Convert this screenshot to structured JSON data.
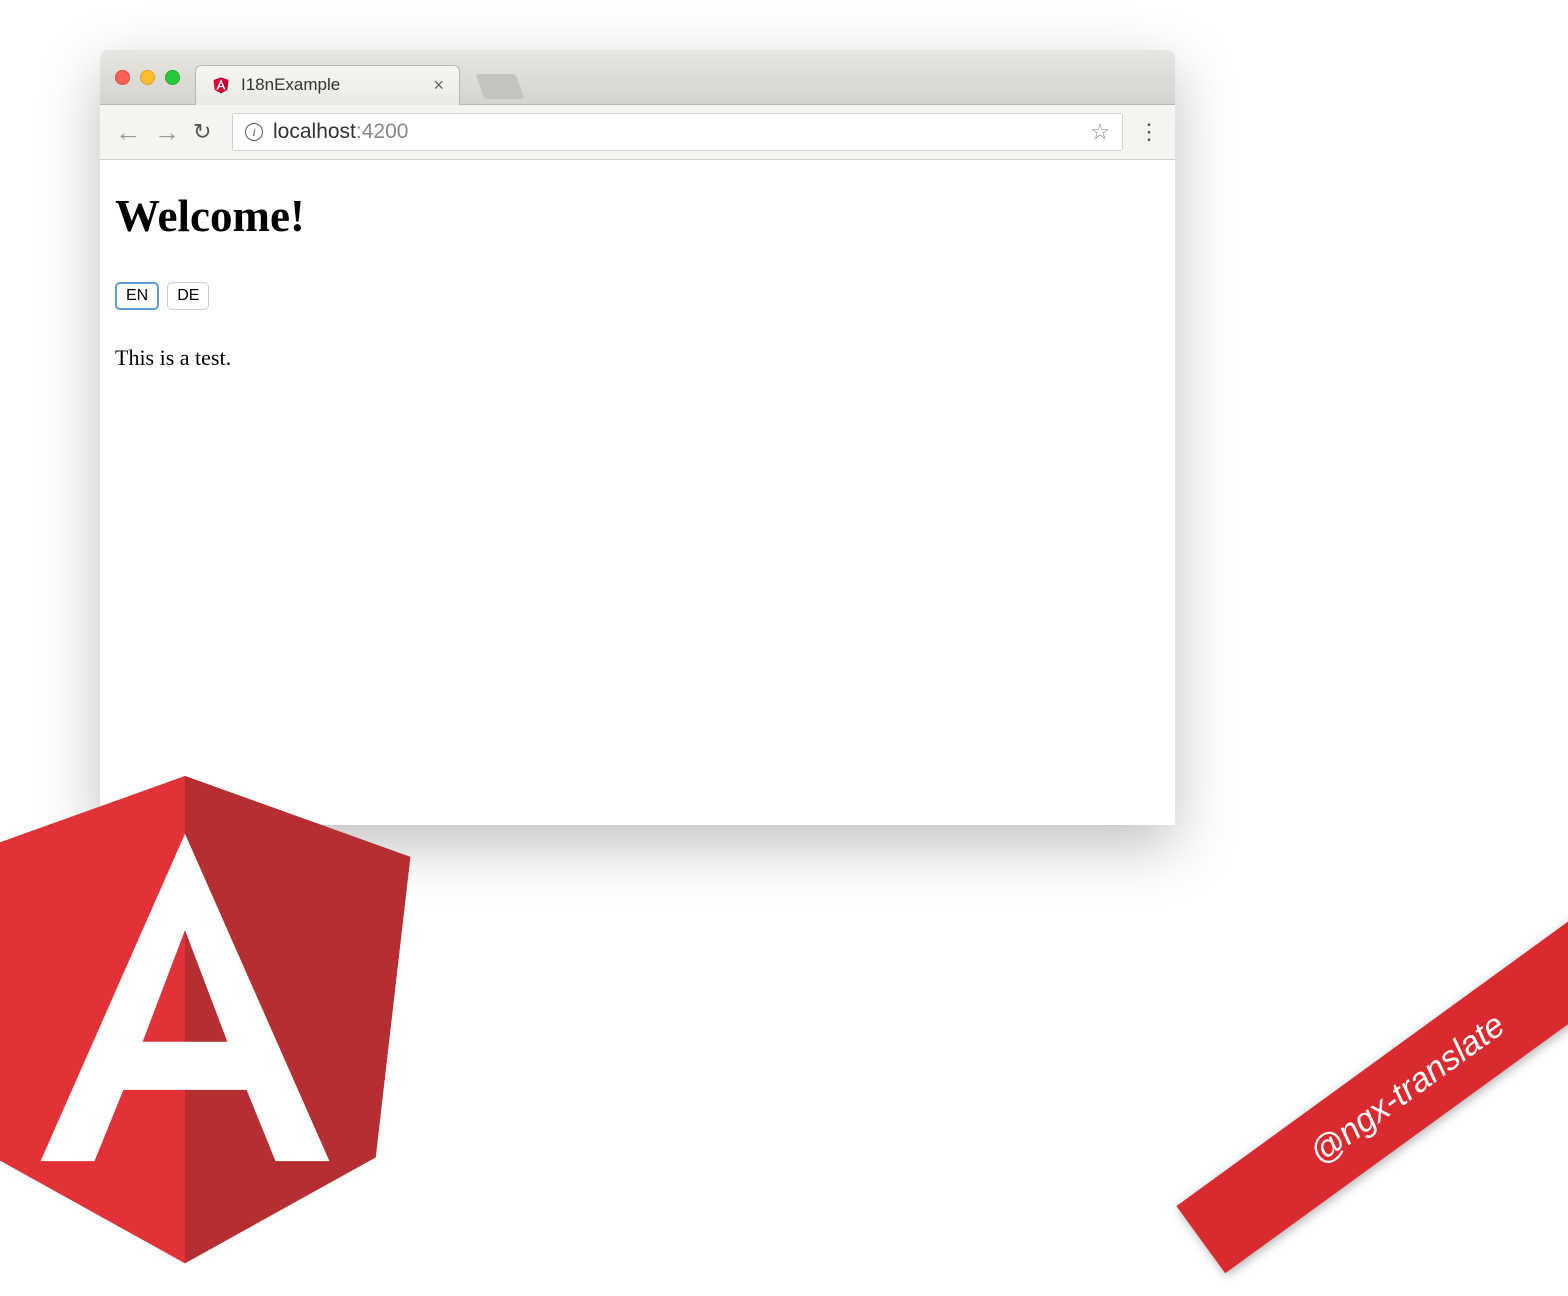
{
  "browser": {
    "tab_title": "I18nExample",
    "url_host": "localhost",
    "url_port": ":4200"
  },
  "page": {
    "heading": "Welcome!",
    "lang_en": "EN",
    "lang_de": "DE",
    "body_text": "This is a test."
  },
  "ribbon": {
    "text": "@ngx-translate"
  }
}
